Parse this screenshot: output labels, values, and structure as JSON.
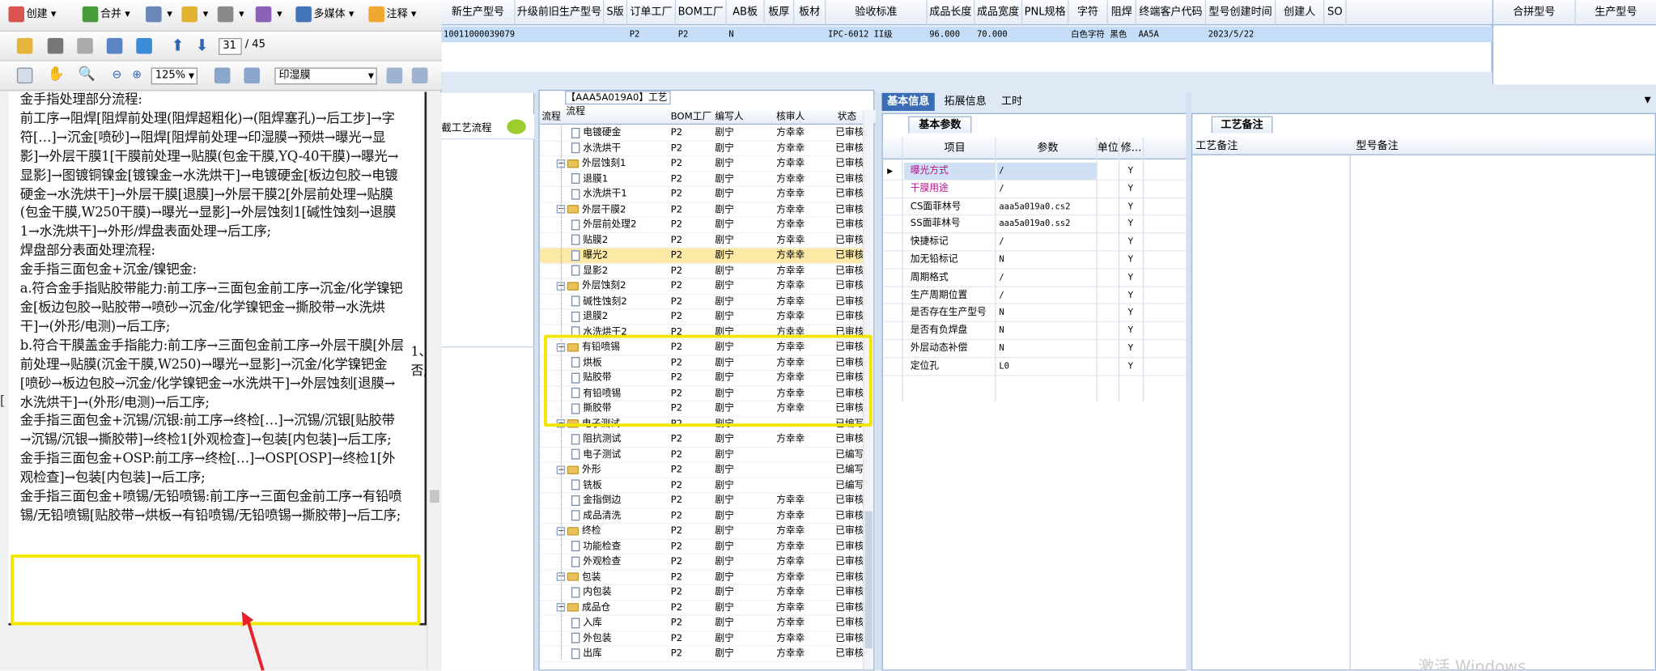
{
  "toolbar": {
    "create": "创建",
    "merge": "合并",
    "secure": "",
    "sign": "",
    "forms": "",
    "multimedia": "多媒体",
    "comment": "注释",
    "page_current": "31",
    "page_total": "/ 45",
    "zoom": "125%",
    "search": "印湿膜"
  },
  "pdf_text": [
    "金手指处理部分流程:",
    "前工序→阻焊[阻焊前处理(阻焊超粗化)→(阻焊塞孔)→后工步]→字符[…]→沉金[喷砂]→阻焊[阻焊前处理→印湿膜→预烘→曝光→显影]→外层干膜1[干膜前处理→贴膜(包金干膜,YQ-40干膜)→曝光→显影]→图镀铜镍金[镀镍金→水洗烘干]→电镀硬金[板边包胶→电镀硬金→水洗烘干]→外层干膜[退膜]→外层干膜2[外层前处理→贴膜(包金干膜,W250干膜)→曝光→显影]→外层蚀刻1[碱性蚀刻→退膜1→水洗烘干]→外形/焊盘表面处理→后工序;",
    "焊盘部分表面处理流程:",
    "金手指三面包金+沉金/镍钯金:",
    "a.符合金手指贴胶带能力:前工序→三面包金前工序→沉金/化学镍钯金[板边包胶→贴胶带→喷砂→沉金/化学镍钯金→撕胶带→水洗烘干]→(外形/电测)→后工序;",
    "b.符合干膜盖金手指能力:前工序→三面包金前工序→外层干膜[外层前处理→贴膜(沉金干膜,W250)→曝光→显影]→沉金/化学镍钯金[喷砂→板边包胶→沉金/化学镍钯金→水洗烘干]→外层蚀刻[退膜→水洗烘干]→(外形/电测)→后工序;",
    "金手指三面包金+沉锡/沉银:前工序→终检[…]→沉锡/沉银[贴胶带→沉锡/沉银→撕胶带]→终检1[外观检查]→包装[内包装]→后工序;",
    "金手指三面包金+OSP:前工序→终检[…]→OSP[OSP]→终检1[外观检查]→包装[内包装]→后工序;",
    "金手指三面包金+喷锡/无铅喷锡:前工序→三面包金前工序→有铅喷锡/无铅喷锡[贴胶带→烘板→有铅喷锡/无铅喷锡→撕胶带]→后工序;"
  ],
  "side_text": [
    "1、",
    "否;"
  ],
  "top_grid": {
    "headers": [
      "新生产型号",
      "升级前旧生产型号",
      "S版",
      "订单工厂",
      "BOM工厂",
      "AB板",
      "板厚",
      "板材",
      "验收标准",
      "成品长度",
      "成品宽度",
      "PNL规格",
      "字符",
      "阻焊",
      "终端客户代码",
      "型号创建时间",
      "创建人",
      "SO"
    ],
    "row": [
      "10011000039079",
      "",
      "",
      "P2",
      "P2",
      "N",
      "",
      "",
      "IPC-6012 II级",
      "96.000",
      "70.000",
      "",
      "白色字符",
      "黑色",
      "AA5A",
      "2023/5/22",
      "",
      ""
    ]
  },
  "right_grid_headers": [
    "合拼型号",
    "生产型号"
  ],
  "left_mid_label": "截工艺流程",
  "flow": {
    "title": "【AAA5A019A0】工艺流程",
    "headers": [
      "流程",
      "BOM工厂",
      "编写人",
      "核审人",
      "状态"
    ],
    "rows": [
      {
        "name": "电镀硬金",
        "level": 2,
        "bom": "P2",
        "writer": "剧宁",
        "checker": "方幸幸",
        "status": "已审核"
      },
      {
        "name": "水洗烘干",
        "level": 2,
        "bom": "P2",
        "writer": "剧宁",
        "checker": "方幸幸",
        "status": "已审核"
      },
      {
        "name": "外层蚀刻1",
        "level": 1,
        "bom": "P2",
        "writer": "剧宁",
        "checker": "方幸幸",
        "status": "已审核"
      },
      {
        "name": "退膜1",
        "level": 2,
        "bom": "P2",
        "writer": "剧宁",
        "checker": "方幸幸",
        "status": "已审核"
      },
      {
        "name": "水洗烘干1",
        "level": 2,
        "bom": "P2",
        "writer": "剧宁",
        "checker": "方幸幸",
        "status": "已审核"
      },
      {
        "name": "外层干膜2",
        "level": 1,
        "bom": "P2",
        "writer": "剧宁",
        "checker": "方幸幸",
        "status": "已审核"
      },
      {
        "name": "外层前处理2",
        "level": 2,
        "bom": "P2",
        "writer": "剧宁",
        "checker": "方幸幸",
        "status": "已审核"
      },
      {
        "name": "贴膜2",
        "level": 2,
        "bom": "P2",
        "writer": "剧宁",
        "checker": "方幸幸",
        "status": "已审核"
      },
      {
        "name": "曝光2",
        "level": 2,
        "bom": "P2",
        "writer": "剧宁",
        "checker": "方幸幸",
        "status": "已审核",
        "selected": true
      },
      {
        "name": "显影2",
        "level": 2,
        "bom": "P2",
        "writer": "剧宁",
        "checker": "方幸幸",
        "status": "已审核"
      },
      {
        "name": "外层蚀刻2",
        "level": 1,
        "bom": "P2",
        "writer": "剧宁",
        "checker": "方幸幸",
        "status": "已审核"
      },
      {
        "name": "碱性蚀刻2",
        "level": 2,
        "bom": "P2",
        "writer": "剧宁",
        "checker": "方幸幸",
        "status": "已审核"
      },
      {
        "name": "退膜2",
        "level": 2,
        "bom": "P2",
        "writer": "剧宁",
        "checker": "方幸幸",
        "status": "已审核"
      },
      {
        "name": "水洗烘干2",
        "level": 2,
        "bom": "P2",
        "writer": "剧宁",
        "checker": "方幸幸",
        "status": "已审核"
      },
      {
        "name": "有铅喷锡",
        "level": 1,
        "bom": "P2",
        "writer": "剧宁",
        "checker": "方幸幸",
        "status": "已审核"
      },
      {
        "name": "烘板",
        "level": 2,
        "bom": "P2",
        "writer": "剧宁",
        "checker": "方幸幸",
        "status": "已审核"
      },
      {
        "name": "贴胶带",
        "level": 2,
        "bom": "P2",
        "writer": "剧宁",
        "checker": "方幸幸",
        "status": "已审核"
      },
      {
        "name": "有铅喷锡",
        "level": 2,
        "bom": "P2",
        "writer": "剧宁",
        "checker": "方幸幸",
        "status": "已审核"
      },
      {
        "name": "撕胶带",
        "level": 2,
        "bom": "P2",
        "writer": "剧宁",
        "checker": "方幸幸",
        "status": "已审核"
      },
      {
        "name": "电子测试",
        "level": 1,
        "bom": "P2",
        "writer": "剧宁",
        "checker": "",
        "status": "已编写"
      },
      {
        "name": "阻抗测试",
        "level": 2,
        "bom": "P2",
        "writer": "剧宁",
        "checker": "方幸幸",
        "status": "已审核"
      },
      {
        "name": "电子测试",
        "level": 2,
        "bom": "P2",
        "writer": "剧宁",
        "checker": "",
        "status": "已编写"
      },
      {
        "name": "外形",
        "level": 1,
        "bom": "P2",
        "writer": "剧宁",
        "checker": "",
        "status": "已编写"
      },
      {
        "name": "铣板",
        "level": 2,
        "bom": "P2",
        "writer": "剧宁",
        "checker": "",
        "status": "已编写"
      },
      {
        "name": "金指倒边",
        "level": 2,
        "bom": "P2",
        "writer": "剧宁",
        "checker": "方幸幸",
        "status": "已审核"
      },
      {
        "name": "成品清洗",
        "level": 2,
        "bom": "P2",
        "writer": "剧宁",
        "checker": "方幸幸",
        "status": "已审核"
      },
      {
        "name": "终检",
        "level": 1,
        "bom": "P2",
        "writer": "剧宁",
        "checker": "方幸幸",
        "status": "已审核"
      },
      {
        "name": "功能检查",
        "level": 2,
        "bom": "P2",
        "writer": "剧宁",
        "checker": "方幸幸",
        "status": "已审核"
      },
      {
        "name": "外观检查",
        "level": 2,
        "bom": "P2",
        "writer": "剧宁",
        "checker": "方幸幸",
        "status": "已审核"
      },
      {
        "name": "包装",
        "level": 1,
        "bom": "P2",
        "writer": "剧宁",
        "checker": "方幸幸",
        "status": "已审核"
      },
      {
        "name": "内包装",
        "level": 2,
        "bom": "P2",
        "writer": "剧宁",
        "checker": "方幸幸",
        "status": "已审核"
      },
      {
        "name": "成品仓",
        "level": 1,
        "bom": "P2",
        "writer": "剧宁",
        "checker": "方幸幸",
        "status": "已审核"
      },
      {
        "name": "入库",
        "level": 2,
        "bom": "P2",
        "writer": "剧宁",
        "checker": "方幸幸",
        "status": "已审核"
      },
      {
        "name": "外包装",
        "level": 2,
        "bom": "P2",
        "writer": "剧宁",
        "checker": "方幸幸",
        "status": "已审核"
      },
      {
        "name": "出库",
        "level": 2,
        "bom": "P2",
        "writer": "剧宁",
        "checker": "方幸幸",
        "status": "已审核"
      }
    ]
  },
  "tabs": [
    "基本信息",
    "拓展信息",
    "工时"
  ],
  "params": {
    "tab": "基本参数",
    "headers": [
      "项目",
      "参数",
      "单位",
      "修..."
    ],
    "rows": [
      {
        "item": "曝光方式",
        "value": "/",
        "unit": "",
        "mod": "Y",
        "highlight": true
      },
      {
        "item": "干膜用途",
        "value": "/",
        "unit": "",
        "mod": "Y",
        "highlight": true
      },
      {
        "item": "CS面菲林号",
        "value": "aaa5a019a0.cs2",
        "unit": "",
        "mod": "Y"
      },
      {
        "item": "SS面菲林号",
        "value": "aaa5a019a0.ss2",
        "unit": "",
        "mod": "Y"
      },
      {
        "item": "快捷标记",
        "value": "/",
        "unit": "",
        "mod": "Y"
      },
      {
        "item": "加无铅标记",
        "value": "N",
        "unit": "",
        "mod": "Y"
      },
      {
        "item": "周期格式",
        "value": "/",
        "unit": "",
        "mod": "Y"
      },
      {
        "item": "生产周期位置",
        "value": "/",
        "unit": "",
        "mod": "Y"
      },
      {
        "item": "是否存在生产型号",
        "value": "N",
        "unit": "",
        "mod": "Y"
      },
      {
        "item": "是否有负焊盘",
        "value": "N",
        "unit": "",
        "mod": "Y"
      },
      {
        "item": "外层动态补偿",
        "value": "N",
        "unit": "",
        "mod": "Y"
      },
      {
        "item": "定位孔",
        "value": "L0",
        "unit": "",
        "mod": "Y"
      }
    ]
  },
  "notes": {
    "tab": "工艺备注",
    "headers": [
      "工艺备注",
      "型号备注"
    ]
  },
  "watermark": "激活 Windows",
  "colors": {
    "highlight_box": "#f2e600",
    "arrow": "#e8202a",
    "selected_row": "#fde9a6",
    "panel_bg": "#dfe9f5"
  }
}
